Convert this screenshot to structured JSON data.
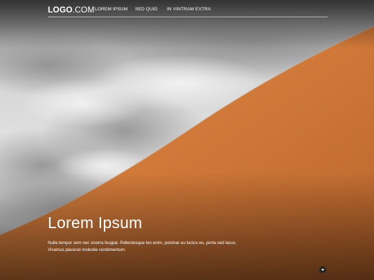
{
  "header": {
    "logo_main": "LOGO",
    "logo_tld": ".COM",
    "nav": [
      "LOREM IPSUM",
      "SED QUID",
      "IN VINTRAM EXTRA"
    ]
  },
  "hero": {
    "image": "desert-sand-dune-under-cloudy-sky",
    "title": "Lorem Ipsum",
    "text_line1": "Nulla tempor sem nec viverra feugiat. Pellentesque leo enim, pulvinar eu luctus eu, porta sed lacus.",
    "text_line2": "Vivamus placerat molestie condimentum.",
    "scroll_icon": "chevron-down-icon"
  },
  "colors": {
    "sky": "#d9d9d9",
    "dune": "#d87f3e",
    "text": "#ffffff"
  }
}
